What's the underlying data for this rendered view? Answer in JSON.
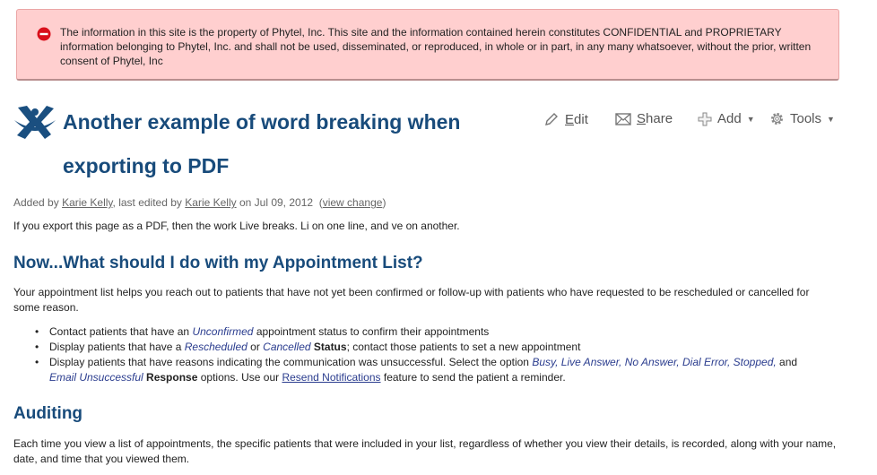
{
  "banner": {
    "text": "The information in this site is the property of Phytel, Inc. This site and the information contained herein constitutes CONFIDENTIAL and PROPRIETARY information belonging to Phytel, Inc. and shall not be used, disseminated, or reproduced, in whole or in part, in any many whatsoever, without the prior, written consent of Phytel, Inc",
    "icon": "error-icon",
    "bg_color": "#ffcfcf"
  },
  "page": {
    "title": "Another example of word breaking when exporting to PDF",
    "title_color": "#184b7b"
  },
  "toolbar": {
    "edit": "Edit",
    "share": "Share",
    "add": "Add",
    "tools": "Tools"
  },
  "meta": {
    "added_by_prefix": "Added by",
    "author": "Karie Kelly",
    "edited_by": ", last edited by",
    "editor": "Karie Kelly",
    "on_date": "on Jul 09, 2012",
    "view_change": "view change"
  },
  "content": {
    "intro": "If you export this page as a PDF, then the work Live breaks.  Li on one line, and ve on another.",
    "section1_heading": "Now...What should I do with my Appointment List?",
    "section1_para": "Your appointment list helps you reach out to patients that have not yet been confirmed or follow-up with patients who have requested to be rescheduled or cancelled for some reason.",
    "bullet1": {
      "a": "Contact patients that have an ",
      "unconfirmed": "Unconfirmed",
      "b": " appointment status to confirm their appointments"
    },
    "bullet2": {
      "a": "Display patients that have a ",
      "rescheduled": "Rescheduled",
      "or": " or ",
      "cancelled": "Cancelled",
      "status": "Status",
      "b": "; contact those patients to set a new appointment"
    },
    "bullet3": {
      "a": "Display patients that have reasons indicating the communication was unsuccessful. Select the option ",
      "busy": "Busy,",
      "live_answer": "Live Answer,",
      "no_answer": "No Answer,",
      "dial_error": "Dial Error,",
      "stopped": "Stopped,",
      "and": " and ",
      "email_unsuccessful": "Email Unsuccessful",
      "response": "Response",
      "b": " options. Use our ",
      "resend": "Resend Notifications",
      "c": " feature to send the patient a reminder."
    },
    "section2_heading": "Auditing",
    "section2_para": "Each time you view a list of appointments, the specific patients that were included in your list, regardless of whether you view their details, is recorded, along with your name, date, and time that you viewed them."
  }
}
